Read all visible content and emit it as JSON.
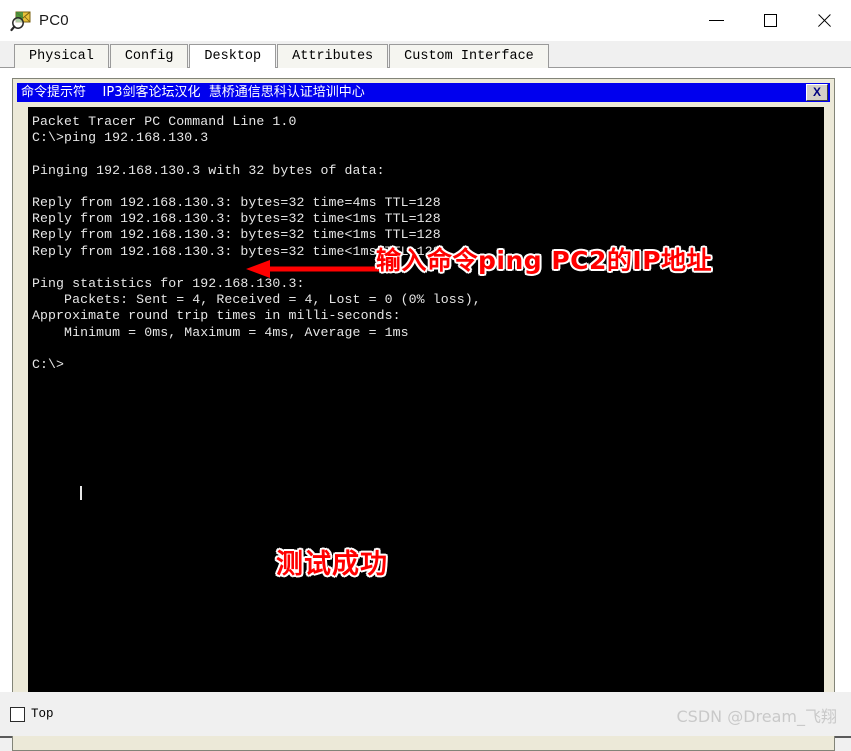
{
  "window": {
    "title": "PC0",
    "icon": "inspect-envelope-icon",
    "controls": {
      "minimize": "minimize-icon",
      "maximize": "maximize-icon",
      "close": "close-icon"
    }
  },
  "tabs": [
    {
      "label": "Physical",
      "active": false
    },
    {
      "label": "Config",
      "active": false
    },
    {
      "label": "Desktop",
      "active": true
    },
    {
      "label": "Attributes",
      "active": false
    },
    {
      "label": "Custom Interface",
      "active": false
    }
  ],
  "cmd_window": {
    "title": "命令提示符    IP3剑客论坛汉化  慧桥通信思科认证培训中心",
    "close_label": "X",
    "titlebar_color": "#0000ee"
  },
  "terminal": {
    "background": "#000000",
    "foreground": "#e6e6e6",
    "lines": [
      "Packet Tracer PC Command Line 1.0",
      "C:\\>ping 192.168.130.3",
      "",
      "Pinging 192.168.130.3 with 32 bytes of data:",
      "",
      "Reply from 192.168.130.3: bytes=32 time=4ms TTL=128",
      "Reply from 192.168.130.3: bytes=32 time<1ms TTL=128",
      "Reply from 192.168.130.3: bytes=32 time<1ms TTL=128",
      "Reply from 192.168.130.3: bytes=32 time<1ms TTL=128",
      "",
      "Ping statistics for 192.168.130.3:",
      "    Packets: Sent = 4, Received = 4, Lost = 0 (0% loss),",
      "Approximate round trip times in milli-seconds:",
      "    Minimum = 0ms, Maximum = 4ms, Average = 1ms",
      "",
      "C:\\>"
    ],
    "prompt": "C:\\>",
    "command": "ping 192.168.130.3",
    "target_ip": "192.168.130.3",
    "packet_size": "32",
    "ttl": "128",
    "packets_sent": "4",
    "packets_received": "4",
    "packets_lost": "0",
    "loss_percent": "0%",
    "rtt_min": "0ms",
    "rtt_max": "4ms",
    "rtt_avg": "1ms"
  },
  "annotations": {
    "command_note": "输入命令ping PC2的IP地址",
    "success_note": "测试成功",
    "arrow_color": "#ff0000",
    "text_color": "#ff0000"
  },
  "bottom": {
    "top_checkbox_label": "Top",
    "top_checkbox_checked": false,
    "watermark": "CSDN @Dream_飞翔"
  }
}
